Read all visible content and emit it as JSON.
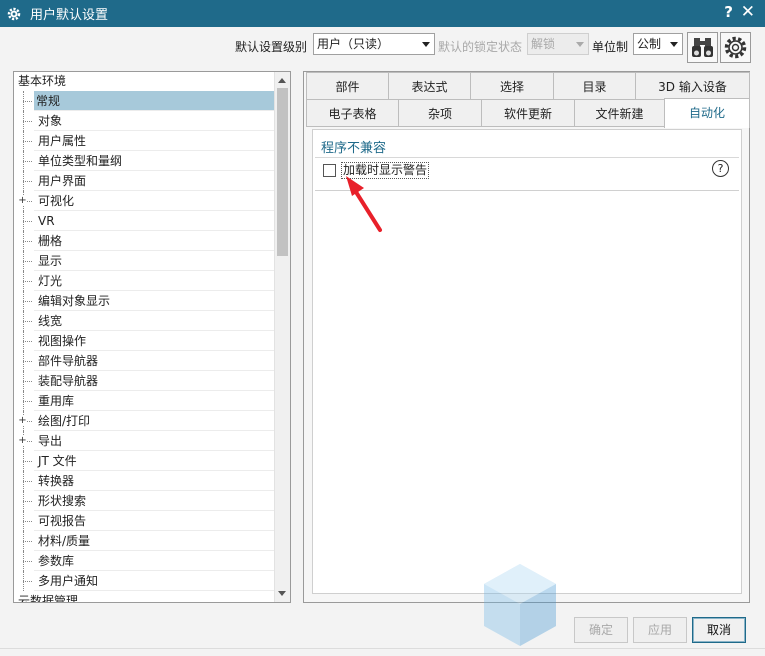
{
  "window": {
    "title": "用户默认设置",
    "help": "?",
    "close": "✕"
  },
  "toolbar": {
    "level_label": "默认设置级别",
    "level_value": "用户（只读）",
    "lock_label": "默认的锁定状态",
    "lock_value": "解锁",
    "unit_label": "单位制",
    "unit_value": "公制"
  },
  "tree": {
    "items": [
      {
        "label": "基本环境",
        "indent": 0,
        "expander": false
      },
      {
        "label": "常规",
        "indent": 1,
        "expander": false,
        "selected": true
      },
      {
        "label": "对象",
        "indent": 1,
        "expander": false
      },
      {
        "label": "用户属性",
        "indent": 1,
        "expander": false
      },
      {
        "label": "单位类型和量纲",
        "indent": 1,
        "expander": false
      },
      {
        "label": "用户界面",
        "indent": 1,
        "expander": false
      },
      {
        "label": "可视化",
        "indent": 1,
        "expander": true
      },
      {
        "label": "VR",
        "indent": 1,
        "expander": false
      },
      {
        "label": "栅格",
        "indent": 1,
        "expander": false
      },
      {
        "label": "显示",
        "indent": 1,
        "expander": false
      },
      {
        "label": "灯光",
        "indent": 1,
        "expander": false
      },
      {
        "label": "编辑对象显示",
        "indent": 1,
        "expander": false
      },
      {
        "label": "线宽",
        "indent": 1,
        "expander": false
      },
      {
        "label": "视图操作",
        "indent": 1,
        "expander": false
      },
      {
        "label": "部件导航器",
        "indent": 1,
        "expander": false
      },
      {
        "label": "装配导航器",
        "indent": 1,
        "expander": false
      },
      {
        "label": "重用库",
        "indent": 1,
        "expander": false
      },
      {
        "label": "绘图/打印",
        "indent": 1,
        "expander": true
      },
      {
        "label": "导出",
        "indent": 1,
        "expander": true
      },
      {
        "label": "JT 文件",
        "indent": 1,
        "expander": false
      },
      {
        "label": "转换器",
        "indent": 1,
        "expander": false
      },
      {
        "label": "形状搜索",
        "indent": 1,
        "expander": false
      },
      {
        "label": "可视报告",
        "indent": 1,
        "expander": false
      },
      {
        "label": "材料/质量",
        "indent": 1,
        "expander": false
      },
      {
        "label": "参数库",
        "indent": 1,
        "expander": false
      },
      {
        "label": "多用户通知",
        "indent": 1,
        "expander": false
      },
      {
        "label": "云数据管理",
        "indent": 0,
        "expander": false
      }
    ]
  },
  "tabs": {
    "row1": [
      "部件",
      "表达式",
      "选择",
      "目录",
      "3D 输入设备"
    ],
    "row2": [
      "电子表格",
      "杂项",
      "软件更新",
      "文件新建",
      "自动化"
    ],
    "active": "自动化"
  },
  "content": {
    "group_title": "程序不兼容",
    "checkbox_label": "加载时显示警告",
    "checkbox_checked": false,
    "help_glyph": "?"
  },
  "buttons": {
    "ok": "确定",
    "apply": "应用",
    "cancel": "取消"
  },
  "colors": {
    "accent": "#1f6a8a",
    "selection": "#a7c9da",
    "annotation_arrow": "#e8202a"
  }
}
